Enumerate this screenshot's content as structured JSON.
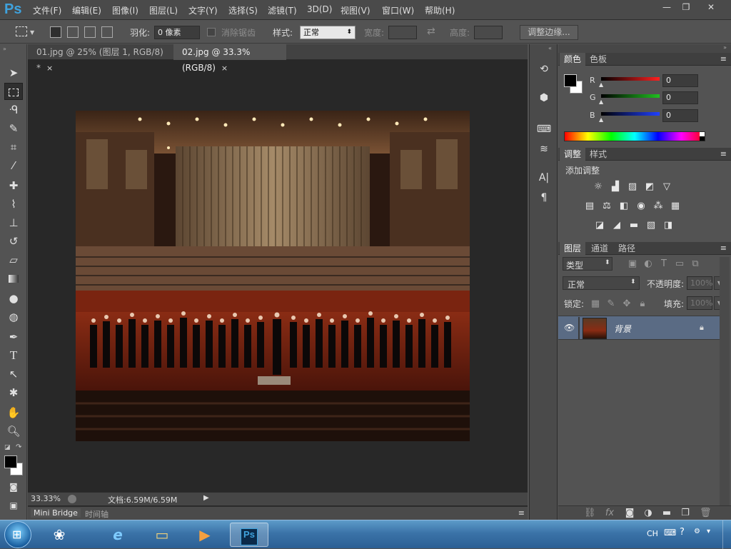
{
  "app": {
    "logo": "Ps"
  },
  "menu": [
    "文件(F)",
    "编辑(E)",
    "图像(I)",
    "图层(L)",
    "文字(Y)",
    "选择(S)",
    "滤镜(T)",
    "3D(D)",
    "视图(V)",
    "窗口(W)",
    "帮助(H)"
  ],
  "window_controls": [
    "—",
    "❐",
    "✕"
  ],
  "options": {
    "feather_label": "羽化:",
    "feather_value": "0 像素",
    "antialias_label": "消除锯齿",
    "style_label": "样式:",
    "style_value": "正常",
    "width_label": "宽度:",
    "height_label": "高度:",
    "refine_edge_label": "调整边缘..."
  },
  "tabs": [
    {
      "label": "01.jpg @ 25% (图层 1, RGB/8) *",
      "close": "×"
    },
    {
      "label": "02.jpg @ 33.3%(RGB/8)",
      "close": "×"
    }
  ],
  "status": {
    "zoom": "33.33%",
    "doc": "文档:6.59M/6.59M"
  },
  "bridge": {
    "tab1": "Mini Bridge",
    "tab2": "时间轴"
  },
  "color_panel": {
    "tab_color": "颜色",
    "tab_swatches": "色板",
    "channels": [
      {
        "name": "R",
        "value": "0",
        "color": "#ff2020"
      },
      {
        "name": "G",
        "value": "0",
        "color": "#20c020"
      },
      {
        "name": "B",
        "value": "0",
        "color": "#2040ff"
      }
    ],
    "foreground": "#000000",
    "background": "#ffffff"
  },
  "adjustments_panel": {
    "tab_adjust": "调整",
    "tab_styles": "样式",
    "title": "添加调整"
  },
  "layers_panel": {
    "tab_layers": "图层",
    "tab_channels": "通道",
    "tab_paths": "路径",
    "filter_kind": "类型",
    "blend_mode": "正常",
    "opacity_label": "不透明度:",
    "opacity_value": "100%",
    "lock_label": "锁定:",
    "fill_label": "填充:",
    "fill_value": "100%",
    "layer_name": "背景"
  },
  "taskbar": {
    "lang": "CH"
  }
}
